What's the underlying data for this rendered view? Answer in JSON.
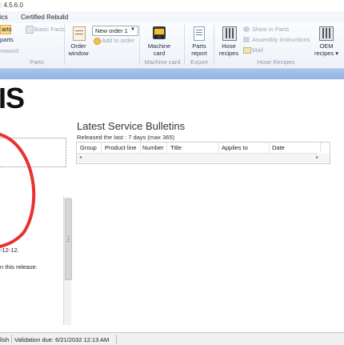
{
  "titlebar": {
    "text": ": 4.5.6.0"
  },
  "menu": {
    "items": [
      "ics",
      "Certified Rebuild"
    ]
  },
  "ribbon": {
    "parts_group": {
      "item1": "arts",
      "item2": "parts",
      "item3": "roword",
      "basic_facts": "Basic Facts",
      "label": "Parts"
    },
    "order_window": {
      "line1": "Order",
      "line2": "window"
    },
    "order_dropdown": {
      "value": "New order 1"
    },
    "add_to_order": "Add to order",
    "machine_card": {
      "line1": "Machine",
      "line2": "card",
      "group_label": "Machine card"
    },
    "parts_report": {
      "line1": "Parts",
      "line2": "report",
      "group_label": "Export"
    },
    "hose_recipes": {
      "line1": "Hose",
      "line2": "recipes"
    },
    "show_in_parts": "Show in Parts",
    "assembly_instructions": "Assembly instructions",
    "mail": "Mail",
    "hose_group_label": "Hose Recipes",
    "oem_recipes": {
      "line1": "OEM",
      "line2": "recipes ▾"
    }
  },
  "brand": {
    "text": "IS"
  },
  "bulletins": {
    "title": "Latest Service Bulletins",
    "subtitle": "Released the last : 7 days (max 365)",
    "columns": [
      "Group",
      "Product line",
      "Number",
      "Title",
      "Applies to",
      "Date"
    ]
  },
  "left_text": {
    "date_fragment": "-12-12.",
    "release_fragment": "n this release:"
  },
  "status": {
    "language": "lish",
    "validation": "Validation due: 6/21/2032 12:13 AM"
  },
  "colors": {
    "accent_bar": "#9bbbe6",
    "circle": "#e8322f"
  },
  "icons": [
    "machine-card-icon",
    "parts-report-icon",
    "hose-recipes-icon",
    "oem-recipes-icon",
    "mail-icon",
    "show-in-parts-icon"
  ]
}
